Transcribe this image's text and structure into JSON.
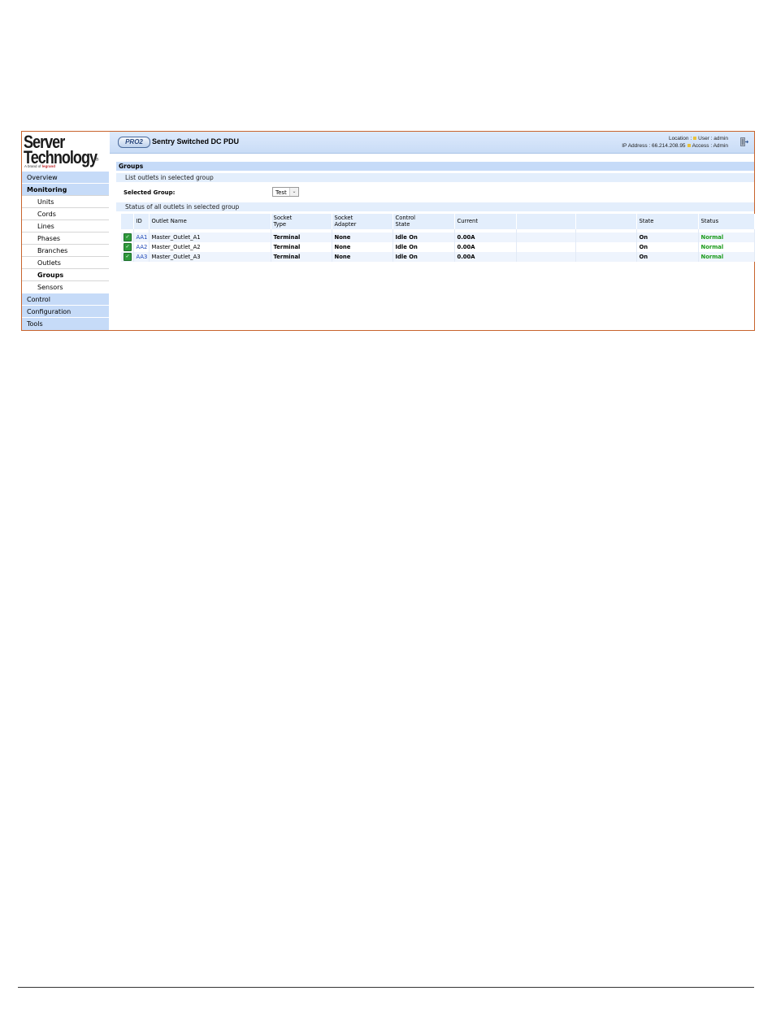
{
  "logo": {
    "line1": "Server",
    "line2": "Technology",
    "reg": "®",
    "tag_prefix": "A brand of",
    "tag_brand": "legrand"
  },
  "sidebar": {
    "items": [
      {
        "label": "Overview",
        "level": "top"
      },
      {
        "label": "Monitoring",
        "level": "top",
        "bold": true
      },
      {
        "label": "Units",
        "level": "sub"
      },
      {
        "label": "Cords",
        "level": "sub"
      },
      {
        "label": "Lines",
        "level": "sub"
      },
      {
        "label": "Phases",
        "level": "sub"
      },
      {
        "label": "Branches",
        "level": "sub"
      },
      {
        "label": "Outlets",
        "level": "sub"
      },
      {
        "label": "Groups",
        "level": "sub",
        "active": true
      },
      {
        "label": "Sensors",
        "level": "sub"
      },
      {
        "label": "Control",
        "level": "top"
      },
      {
        "label": "Configuration",
        "level": "top"
      },
      {
        "label": "Tools",
        "level": "top"
      }
    ]
  },
  "header": {
    "badge": "PRO2",
    "title": "Sentry Switched DC PDU",
    "location_label": "Location :",
    "user_label": "User : admin",
    "ip_label": "IP Address : 66.214.208.95",
    "access_label": "Access : Admin",
    "logout_icon": "logout-icon"
  },
  "page": {
    "section_title": "Groups",
    "list_heading": "List outlets in selected group",
    "selected_group_label": "Selected Group:",
    "selected_group_value": "Test",
    "status_heading": "Status of all outlets in selected group"
  },
  "table": {
    "headers": [
      "",
      "ID",
      "Outlet Name",
      "Socket\nType",
      "Socket\nAdapter",
      "Control\nState",
      "Current",
      "",
      "",
      "State",
      "Status"
    ],
    "rows": [
      {
        "id": "AA1",
        "name": "Master_Outlet_A1",
        "socket_type": "Terminal",
        "adapter": "None",
        "control_state": "Idle On",
        "current": "0.00A",
        "state": "On",
        "status": "Normal"
      },
      {
        "id": "AA2",
        "name": "Master_Outlet_A2",
        "socket_type": "Terminal",
        "adapter": "None",
        "control_state": "Idle On",
        "current": "0.00A",
        "state": "On",
        "status": "Normal"
      },
      {
        "id": "AA3",
        "name": "Master_Outlet_A3",
        "socket_type": "Terminal",
        "adapter": "None",
        "control_state": "Idle On",
        "current": "0.00A",
        "state": "On",
        "status": "Normal"
      }
    ]
  },
  "colors": {
    "nav_bg": "#c6dbf8",
    "frame_border": "#c8642d",
    "status_ok": "#1a9a1a",
    "link": "#1b44b5"
  }
}
